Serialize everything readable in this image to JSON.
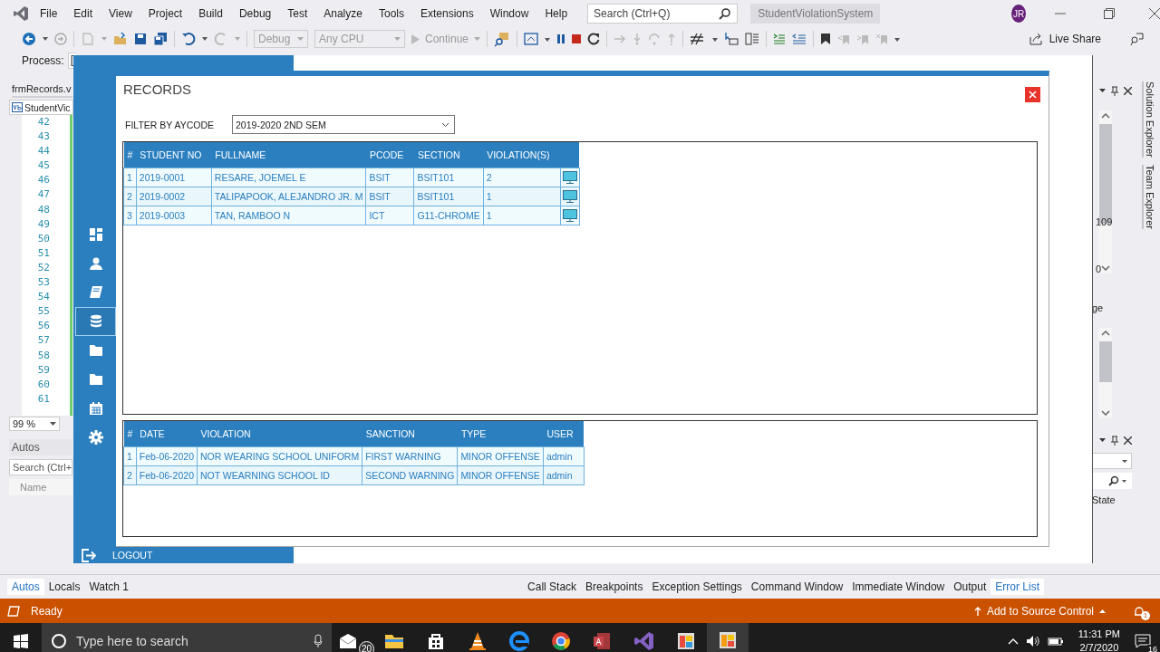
{
  "ide": {
    "menu": [
      "File",
      "Edit",
      "View",
      "Project",
      "Build",
      "Debug",
      "Test",
      "Analyze",
      "Tools",
      "Extensions",
      "Window",
      "Help"
    ],
    "search": {
      "placeholder": "Search (Ctrl+Q)"
    },
    "solution_name": "StudentViolationSystem",
    "user_initials": "JR",
    "toolbar": {
      "configuration": "Debug",
      "platform": "Any CPU",
      "continue": "Continue",
      "live_share": "Live Share"
    },
    "process": {
      "label": "Process:",
      "value": "["
    },
    "document_tab": "frmRecords.v",
    "navigation": "StudentVic",
    "line_numbers": [
      "42",
      "43",
      "44",
      "45",
      "46",
      "47",
      "48",
      "49",
      "50",
      "51",
      "52",
      "53",
      "54",
      "55",
      "56",
      "57",
      "58",
      "59",
      "60",
      "61"
    ],
    "zoom": "99 %",
    "autos": {
      "title": "Autos",
      "search_placeholder": "Search (Ctrl+",
      "column": "Name"
    },
    "right_panel": {
      "value_1": "109",
      "value_2": "0",
      "label": "ge",
      "column": "State"
    },
    "side_tabs": [
      "Solution Explorer",
      "Team Explorer"
    ],
    "bottom_tabs_left": [
      {
        "label": "Autos",
        "selected": true
      },
      {
        "label": "Locals",
        "selected": false
      },
      {
        "label": "Watch 1",
        "selected": false
      }
    ],
    "bottom_tabs_right": [
      {
        "label": "Call Stack",
        "selected": false
      },
      {
        "label": "Breakpoints",
        "selected": false
      },
      {
        "label": "Exception Settings",
        "selected": false
      },
      {
        "label": "Command Window",
        "selected": false
      },
      {
        "label": "Immediate Window",
        "selected": false
      },
      {
        "label": "Output",
        "selected": false
      },
      {
        "label": "Error List",
        "selected": true
      }
    ],
    "status": {
      "text": "Ready",
      "source_control": "Add to Source Control",
      "notifications": "1"
    }
  },
  "app": {
    "title": "RECORDS",
    "nav_items": [
      {
        "kind": "dashboard",
        "selected": false
      },
      {
        "kind": "user",
        "selected": false
      },
      {
        "kind": "book",
        "selected": false
      },
      {
        "kind": "database",
        "selected": true
      },
      {
        "kind": "folder",
        "selected": false
      },
      {
        "kind": "folder",
        "selected": false
      },
      {
        "kind": "calendar",
        "selected": false
      },
      {
        "kind": "settings",
        "selected": false
      }
    ],
    "logout": "LOGOUT",
    "filter": {
      "label": "FILTER BY AYCODE",
      "value": "2019-2020 2ND SEM"
    },
    "students": {
      "columns": [
        "#",
        "STUDENT NO",
        "FULLNAME",
        "PCODE",
        "SECTION",
        "VIOLATION(S)"
      ],
      "rows": [
        [
          "1",
          "2019-0001",
          "RESARE, JOEMEL E",
          "BSIT",
          "BSIT101",
          "2"
        ],
        [
          "2",
          "2019-0002",
          "TALIPAPOOK, ALEJANDRO JR. M",
          "BSIT",
          "BSIT101",
          "1"
        ],
        [
          "3",
          "2019-0003",
          "TAN, RAMBOO N",
          "ICT",
          "G11-CHROME",
          "1"
        ]
      ]
    },
    "violations": {
      "columns": [
        "#",
        "DATE",
        "VIOLATION",
        "SANCTION",
        "TYPE",
        "USER"
      ],
      "rows": [
        [
          "1",
          "Feb-06-2020",
          "NOR WEARING SCHOOL UNIFORM",
          "FIRST WARNING",
          "MINOR OFFENSE",
          "admin"
        ],
        [
          "2",
          "Feb-06-2020",
          "NOT WEARNING SCHOOL ID",
          "SECOND WARNING",
          "MINOR OFFENSE",
          "admin"
        ]
      ]
    }
  },
  "taskbar": {
    "search_placeholder": "Type here to search",
    "mail_badge": "20",
    "time": "11:31 PM",
    "date": "2/7/2020",
    "notification_count": "16"
  }
}
